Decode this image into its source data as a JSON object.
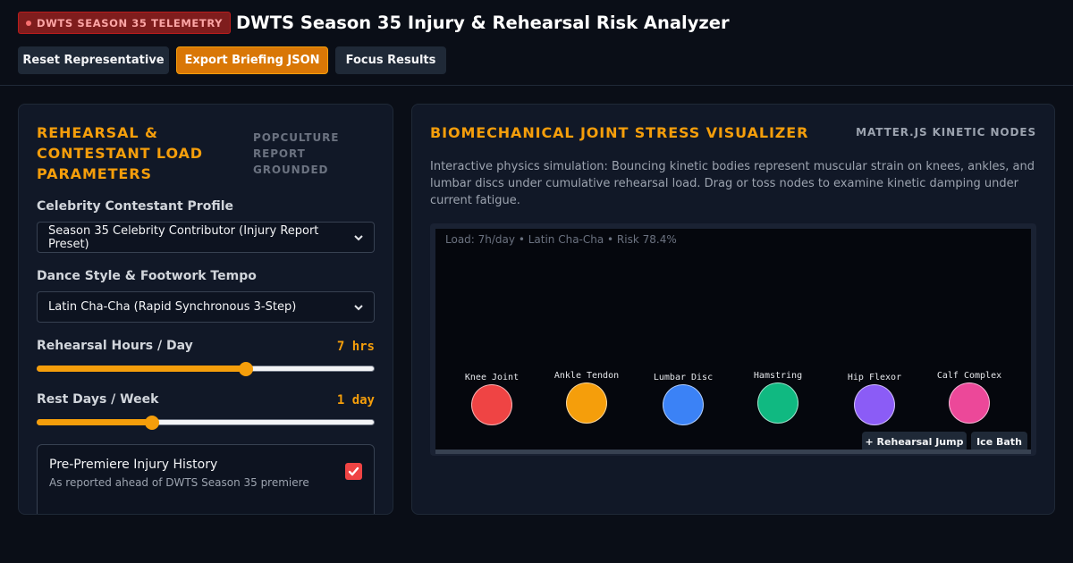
{
  "header": {
    "badge": "DWTS SEASON 35 TELEMETRY",
    "title": "DWTS Season 35 Injury & Rehearsal Risk Analyzer",
    "buttons": {
      "reset": "Reset Representative",
      "export": "Export Briefing JSON",
      "focus": "Focus Results"
    }
  },
  "params": {
    "title": "REHEARSAL & CONTESTANT LOAD PARAMETERS",
    "tag": "POPCULTURE REPORT GROUNDED",
    "profile": {
      "label": "Celebrity Contestant Profile",
      "value": "Season 35 Celebrity Contributor (Injury Report Preset)"
    },
    "style": {
      "label": "Dance Style & Footwork Tempo",
      "value": "Latin Cha-Cha (Rapid Synchronous 3-Step)"
    },
    "hours": {
      "label": "Rehearsal Hours / Day",
      "value_text": "7 hrs",
      "level": 0.62
    },
    "rest": {
      "label": "Rest Days / Week",
      "value_text": "1 day",
      "level": 0.34
    },
    "injury": {
      "title": "Pre-Premiere Injury History",
      "subtitle": "As reported ahead of DWTS Season 35 premiere",
      "checked": true
    }
  },
  "visualizer": {
    "title": "BIOMECHANICAL JOINT STRESS VISUALIZER",
    "tag": "MATTER.JS KINETIC NODES",
    "description": "Interactive physics simulation: Bouncing kinetic bodies represent muscular strain on knees, ankles, and lumbar discs under cumulative rehearsal load. Drag or toss nodes to examine kinetic damping under current fatigue.",
    "status": "Load: 7h/day • Latin Cha-Cha • Risk 78.4%",
    "nodes": [
      {
        "label": "Knee Joint",
        "color": "#ef4444"
      },
      {
        "label": "Ankle Tendon",
        "color": "#f59e0b"
      },
      {
        "label": "Lumbar Disc",
        "color": "#3b82f6"
      },
      {
        "label": "Hamstring",
        "color": "#10b981"
      },
      {
        "label": "Hip Flexor",
        "color": "#8b5cf6"
      },
      {
        "label": "Calf Complex",
        "color": "#ec4899"
      }
    ],
    "buttons": {
      "jump": "+ Rehearsal Jump",
      "ice": "Ice Bath"
    }
  }
}
